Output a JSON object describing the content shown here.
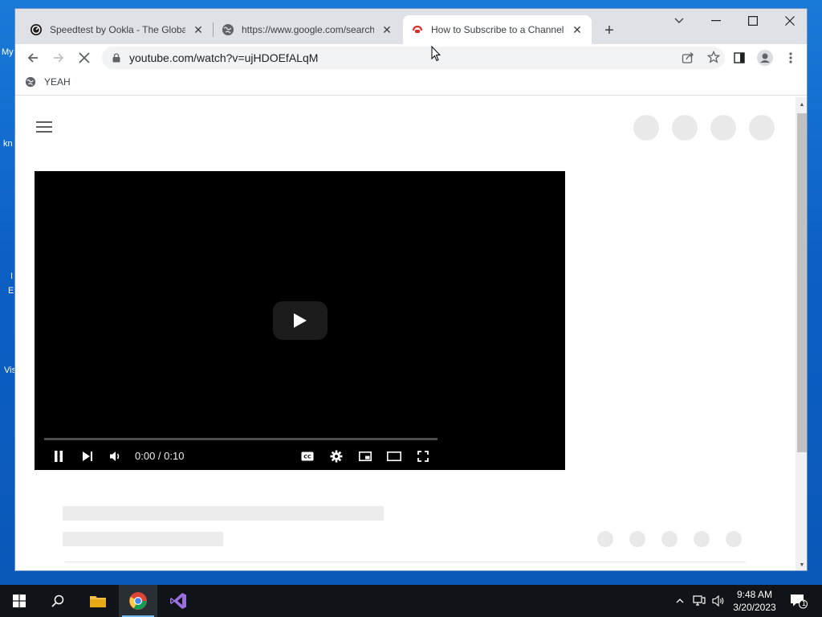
{
  "desktop": {
    "fragments": [
      "My",
      "kn",
      "I",
      "E",
      "Vis"
    ]
  },
  "browser": {
    "tabs": [
      {
        "title": "Speedtest by Ookla - The Global Broadband Speed Test",
        "favicon": "speedtest-icon",
        "active": false
      },
      {
        "title": "https://www.google.com/search?q=",
        "favicon": "globe-icon",
        "active": false
      },
      {
        "title": "How to Subscribe to a Channel on YouTube",
        "favicon": "loading-youtube-icon",
        "active": true
      }
    ],
    "new_tab_label": "+",
    "address": {
      "url": "youtube.com/watch?v=ujHDOEfALqM"
    },
    "bookmarks": [
      {
        "label": "YEAH",
        "icon": "globe-icon"
      }
    ]
  },
  "player": {
    "time": "0:00 / 0:10",
    "progress": 0.0
  },
  "taskbar": {
    "clock_time": "9:48 AM",
    "clock_date": "3/20/2023",
    "notification_count": "1"
  },
  "colors": {
    "desktop_bg": "#0c5fc4",
    "tabstrip_bg": "#dee1e6",
    "taskbar_bg": "#101418",
    "player_bg": "#000000",
    "skeleton": "#ebebeb"
  }
}
